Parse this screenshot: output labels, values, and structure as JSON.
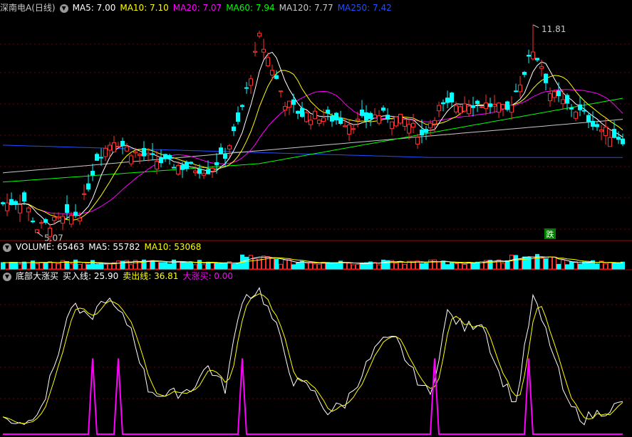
{
  "header": {
    "stock_name": "深南电A(日线)",
    "ma": [
      {
        "label": "MA5: 7.00",
        "color": "#ffffff"
      },
      {
        "label": "MA10: 7.10",
        "color": "#ffff00"
      },
      {
        "label": "MA20: 7.07",
        "color": "#ff00ff"
      },
      {
        "label": "MA60: 7.94",
        "color": "#00ff00"
      },
      {
        "label": "MA120: 7.77",
        "color": "#c8c8c8"
      },
      {
        "label": "MA250: 7.42",
        "color": "#2050ff"
      }
    ]
  },
  "volume_header": {
    "items": [
      {
        "label": "VOLUME: 65463",
        "color": "#ffffff"
      },
      {
        "label": "MA5: 55782",
        "color": "#ffffff"
      },
      {
        "label": "MA10: 53068",
        "color": "#ffff00"
      }
    ]
  },
  "indicator_header": {
    "items": [
      {
        "label": "底部大涨买",
        "color": "#ffffff"
      },
      {
        "label": "买入线: 25.90",
        "color": "#ffffff"
      },
      {
        "label": "卖出线: 36.81",
        "color": "#ffff00"
      },
      {
        "label": "大涨买: 0.00",
        "color": "#ff00ff"
      }
    ]
  },
  "chart_data": [
    {
      "type": "candlestick",
      "annotations": [
        {
          "text": "11.81",
          "kind": "high",
          "value": 11.81,
          "index": 124
        },
        {
          "text": "5.07",
          "kind": "low",
          "value": 5.07,
          "index": 8
        },
        {
          "text": "跌",
          "kind": "signal",
          "index": 128
        }
      ],
      "ma_colors": {
        "ma5": "#ffffff",
        "ma10": "#ffff00",
        "ma20": "#ff00ff",
        "ma60": "#00ff00",
        "ma120": "#c8c8c8",
        "ma250": "#2050ff"
      },
      "up_color": "#ff3030",
      "down_color": "#00ffff"
    },
    {
      "type": "bar",
      "name": "VOLUME"
    },
    {
      "type": "line",
      "name": "底部大涨买",
      "ylim": [
        0,
        100
      ]
    }
  ]
}
